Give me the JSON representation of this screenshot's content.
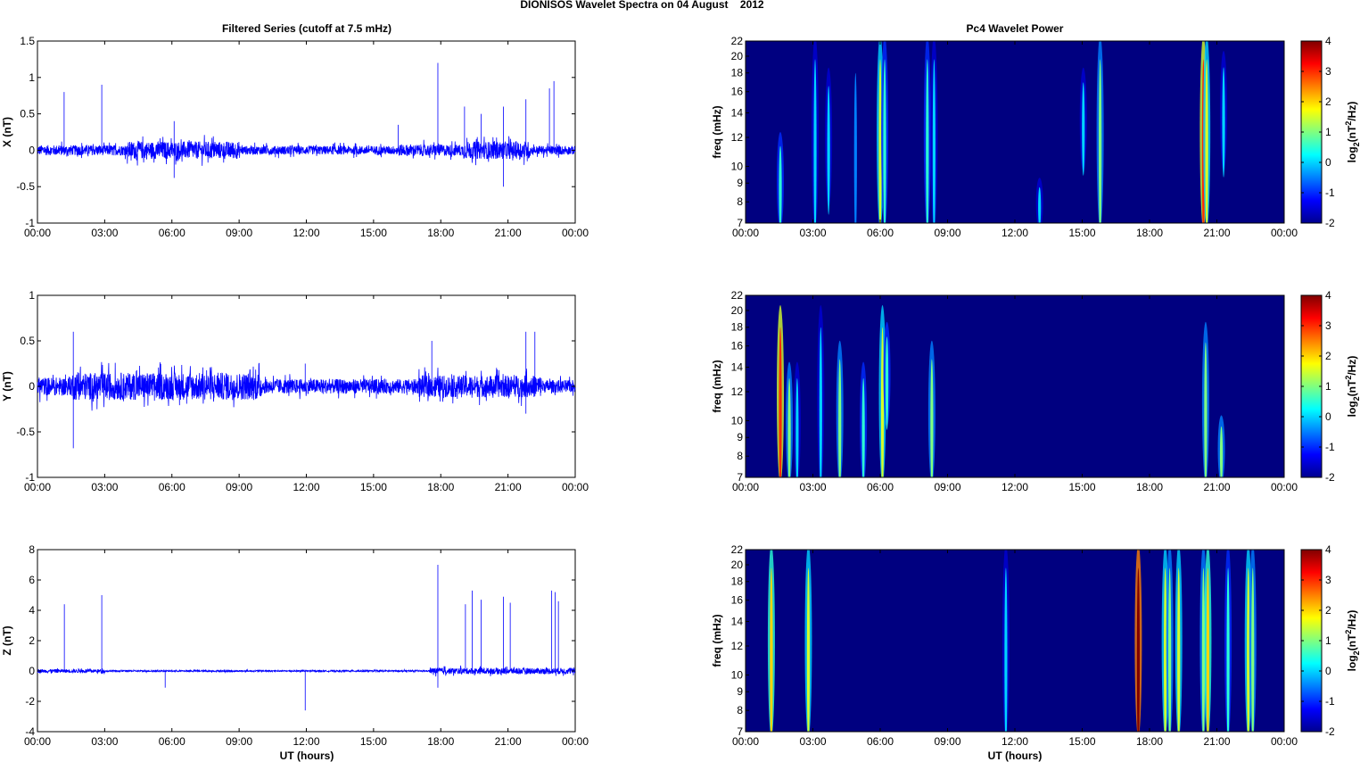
{
  "chart_data": {
    "type": "line+heatmap",
    "title": "DIONISOS Wavelet Spectra on 04 August    2012",
    "left_title": "Filtered Series (cutoff at 7.5 mHz)",
    "right_title": "Pc4 Wavelet Power",
    "xlabel": "UT (hours)",
    "x_range_hours": [
      0,
      24
    ],
    "x_tick_labels": [
      "00:00",
      "03:00",
      "06:00",
      "09:00",
      "12:00",
      "15:00",
      "18:00",
      "21:00",
      "00:00"
    ],
    "series": [
      {
        "name": "X",
        "ylabel": "X (nT)",
        "ylim": [
          -1,
          1.5
        ],
        "yticks": [
          -1,
          -0.5,
          0,
          0.5,
          1,
          1.5
        ],
        "ytick_labels": [
          "-1",
          "-0.5",
          "0",
          "0.5",
          "1",
          "1.5"
        ],
        "color": "#0000ff",
        "noise_envelope": [
          [
            0,
            4,
            0.07
          ],
          [
            4,
            9,
            0.12
          ],
          [
            9,
            16,
            0.06
          ],
          [
            16,
            19,
            0.08
          ],
          [
            19,
            22,
            0.12
          ],
          [
            22,
            24,
            0.06
          ]
        ],
        "spikes": [
          [
            1.19,
            0.8
          ],
          [
            2.87,
            0.9
          ],
          [
            6.1,
            0.4
          ],
          [
            6.1,
            -0.38
          ],
          [
            16.1,
            0.35
          ],
          [
            17.87,
            1.2
          ],
          [
            19.06,
            0.6
          ],
          [
            19.8,
            0.5
          ],
          [
            20.8,
            0.6
          ],
          [
            20.8,
            -0.5
          ],
          [
            21.8,
            0.7
          ],
          [
            22.85,
            0.85
          ],
          [
            23.05,
            0.95
          ]
        ]
      },
      {
        "name": "Y",
        "ylabel": "Y (nT)",
        "ylim": [
          -1,
          1
        ],
        "yticks": [
          -1,
          -0.5,
          0,
          0.5,
          1
        ],
        "ytick_labels": [
          "-1",
          "-0.5",
          "0",
          "0.5",
          "1"
        ],
        "color": "#0000ff",
        "noise_envelope": [
          [
            0,
            1.5,
            0.1
          ],
          [
            1.5,
            10,
            0.15
          ],
          [
            10,
            17,
            0.08
          ],
          [
            17,
            22.5,
            0.12
          ],
          [
            22.5,
            24,
            0.07
          ]
        ],
        "spikes": [
          [
            1.6,
            0.6
          ],
          [
            1.6,
            -0.68
          ],
          [
            11.95,
            0.25
          ],
          [
            17.6,
            0.5
          ],
          [
            21.8,
            0.6
          ],
          [
            22.2,
            0.6
          ],
          [
            21.8,
            -0.3
          ]
        ]
      },
      {
        "name": "Z",
        "ylabel": "Z (nT)",
        "ylim": [
          -4,
          8
        ],
        "yticks": [
          -4,
          -2,
          0,
          2,
          4,
          6,
          8
        ],
        "ytick_labels": [
          "-4",
          "-2",
          "0",
          "2",
          "4",
          "6",
          "8"
        ],
        "color": "#0000ff",
        "noise_envelope": [
          [
            0,
            3,
            0.12
          ],
          [
            3,
            17.5,
            0.05
          ],
          [
            17.5,
            24,
            0.2
          ]
        ],
        "spikes": [
          [
            1.2,
            4.4
          ],
          [
            2.87,
            5.0
          ],
          [
            5.7,
            -1.1
          ],
          [
            11.95,
            -2.6
          ],
          [
            17.87,
            7.0
          ],
          [
            17.87,
            -1.1
          ],
          [
            19.1,
            4.4
          ],
          [
            19.4,
            5.3
          ],
          [
            19.8,
            4.7
          ],
          [
            20.8,
            4.9
          ],
          [
            21.1,
            4.5
          ],
          [
            22.95,
            5.3
          ],
          [
            23.1,
            5.2
          ],
          [
            23.25,
            4.6
          ]
        ]
      }
    ],
    "spectra": {
      "ylabel": "freq (mHz)",
      "yscale": "log",
      "ylim": [
        7,
        22
      ],
      "yticks": [
        7,
        8,
        9,
        10,
        12,
        14,
        16,
        18,
        20,
        22
      ],
      "ytick_labels": [
        "7",
        "8",
        "9",
        "10",
        "12",
        "14",
        "16",
        "18",
        "20",
        "22"
      ],
      "colorbar": {
        "label": "log2(nT^2/Hz)",
        "label_base": "log",
        "label_sub": "2",
        "label_mid": "(nT",
        "label_sup": "2",
        "label_end": "/Hz)",
        "range": [
          -2,
          4
        ],
        "ticks": [
          -2,
          -1,
          0,
          1,
          2,
          3,
          4
        ],
        "tick_labels": [
          "-2",
          "-1",
          "0",
          "1",
          "2",
          "3",
          "4"
        ],
        "colormap": "jet"
      },
      "background_power": -2,
      "panels": [
        {
          "name": "X",
          "bursts": [
            [
              1.55,
              7,
              12,
              0.5
            ],
            [
              3.1,
              7,
              22,
              0
            ],
            [
              3.7,
              8,
              18,
              0
            ],
            [
              4.9,
              7,
              20,
              -0.5
            ],
            [
              6.0,
              7,
              22,
              1.5
            ],
            [
              6.2,
              7,
              22,
              0.5
            ],
            [
              8.1,
              7,
              22,
              0.5
            ],
            [
              8.4,
              7,
              22,
              0
            ],
            [
              13.1,
              7,
              9,
              0
            ],
            [
              15.05,
              10,
              18,
              0
            ],
            [
              15.8,
              7,
              22,
              1
            ],
            [
              20.4,
              7,
              22,
              3
            ],
            [
              20.55,
              7,
              22,
              1.5
            ],
            [
              21.3,
              10,
              20,
              0
            ]
          ]
        },
        {
          "name": "Y",
          "bursts": [
            [
              1.55,
              7,
              20,
              3
            ],
            [
              1.95,
              7,
              14,
              1
            ],
            [
              2.3,
              7,
              14,
              0
            ],
            [
              3.35,
              7,
              20,
              0
            ],
            [
              4.2,
              7,
              16,
              1
            ],
            [
              5.25,
              7,
              14,
              0.5
            ],
            [
              6.1,
              7,
              20,
              1.5
            ],
            [
              6.3,
              10,
              18,
              0.5
            ],
            [
              8.3,
              7,
              16,
              1
            ],
            [
              20.5,
              7,
              18,
              1
            ],
            [
              21.2,
              7,
              10,
              1
            ]
          ]
        },
        {
          "name": "Z",
          "bursts": [
            [
              1.15,
              7,
              22,
              2
            ],
            [
              2.8,
              7,
              22,
              1.5
            ],
            [
              11.6,
              7,
              22,
              0
            ],
            [
              17.5,
              7,
              22,
              4
            ],
            [
              18.7,
              7,
              22,
              1.5
            ],
            [
              18.9,
              7,
              22,
              1
            ],
            [
              19.3,
              7,
              22,
              1.5
            ],
            [
              20.4,
              7,
              22,
              1
            ],
            [
              20.6,
              7,
              22,
              2
            ],
            [
              21.5,
              7,
              22,
              0.5
            ],
            [
              22.4,
              7,
              22,
              1.5
            ],
            [
              22.6,
              7,
              22,
              1
            ]
          ]
        }
      ]
    }
  }
}
